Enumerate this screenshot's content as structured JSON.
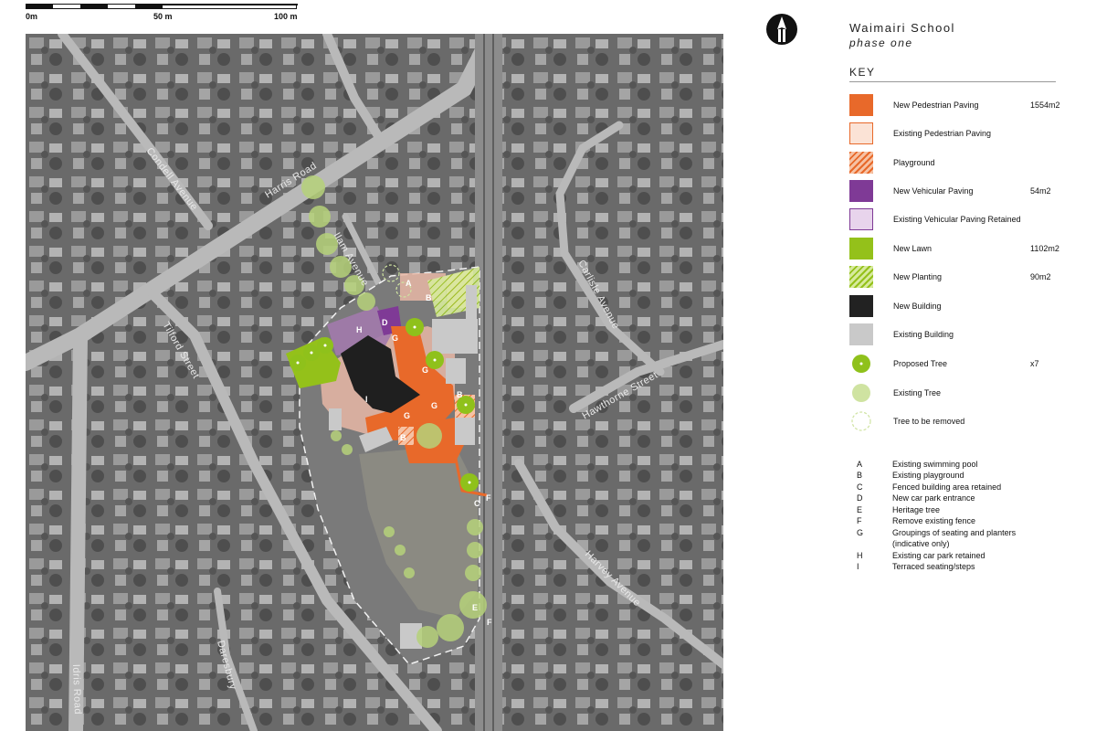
{
  "scale_bar": {
    "labels": [
      "0m",
      "50 m",
      "100 m"
    ]
  },
  "title": "Waimairi School",
  "subtitle": "phase one",
  "key_heading": "KEY",
  "legend": [
    {
      "label": "New Pedestrian Paving",
      "value": "1554m2",
      "color": "#e8692a",
      "symbol": "solid"
    },
    {
      "label": "Existing Pedestrian Paving",
      "value": "",
      "color": "#fbe3d6",
      "border": "#e8692a",
      "symbol": "outline"
    },
    {
      "label": "Playground",
      "value": "",
      "color": "#f29a6a",
      "symbol": "hatch"
    },
    {
      "label": "New Vehicular Paving",
      "value": "54m2",
      "color": "#7f3a96",
      "symbol": "solid"
    },
    {
      "label": "Existing Vehicular Paving Retained",
      "value": "",
      "color": "#e8d4ec",
      "border": "#7f3a96",
      "symbol": "outline"
    },
    {
      "label": "New Lawn",
      "value": "1102m2",
      "color": "#94c11a",
      "symbol": "solid"
    },
    {
      "label": "New Planting",
      "value": "90m2",
      "color": "#94c11a",
      "symbol": "hatch"
    },
    {
      "label": "New Building",
      "value": "",
      "color": "#222222",
      "symbol": "solid"
    },
    {
      "label": "Existing Building",
      "value": "",
      "color": "#c9c9c9",
      "symbol": "solid"
    },
    {
      "label": "Proposed Tree",
      "value": "x7",
      "color": "#8fc11b",
      "symbol": "tree"
    },
    {
      "label": "Existing Tree",
      "value": "",
      "color": "#cfe3a1",
      "symbol": "circle"
    },
    {
      "label": "Tree to be removed",
      "value": "",
      "color": "#cfe3a1",
      "symbol": "dashed-circle"
    }
  ],
  "notes": [
    {
      "letter": "A",
      "text": "Existing swimming pool"
    },
    {
      "letter": "B",
      "text": "Existing playground"
    },
    {
      "letter": "C",
      "text": "Fenced building area retained"
    },
    {
      "letter": "D",
      "text": "New car park entrance"
    },
    {
      "letter": "E",
      "text": "Heritage tree"
    },
    {
      "letter": "F",
      "text": "Remove existing fence"
    },
    {
      "letter": "G",
      "text": "Groupings of seating and planters"
    },
    {
      "letter": "",
      "text": "(indicative only)"
    },
    {
      "letter": "H",
      "text": "Existing car park retained"
    },
    {
      "letter": "I",
      "text": "Terraced seating/steps"
    }
  ],
  "streets": {
    "condell": "Condell Avenue",
    "harris": "Harris Road",
    "ilam": "Ilam Avenue",
    "tilford": "Tilford Street",
    "idris": "Idris Road",
    "daresbury": "Daresbury",
    "carlisle": "Carlisle Avenue",
    "hawthorne": "Hawthorne Street",
    "harvey": "Harvey Avenue"
  },
  "map_labels": [
    "A",
    "B",
    "H",
    "D",
    "G",
    "G",
    "G",
    "G",
    "B",
    "B",
    "C",
    "F",
    "E",
    "F",
    "I"
  ]
}
